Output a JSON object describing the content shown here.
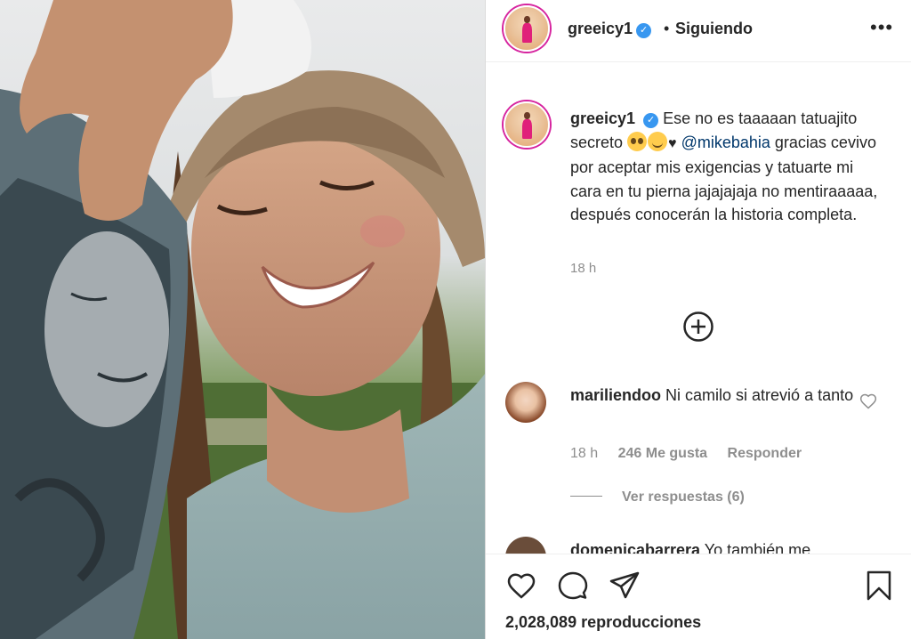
{
  "post": {
    "username": "greeicy1",
    "verified_mark": "✓",
    "separator": "•",
    "follow_status": "Siguiendo",
    "more_icon": "•••",
    "caption_prefix": "Ese no es taaaaan tatuajito secreto",
    "caption_heart": "♥",
    "caption_mention": "@mikebahia",
    "caption_rest": "gracias cevivo por aceptar mis exigencias y tatuarte mi cara en tu pierna jajajajaja no mentiraaaaa, después conocerán la historia completa.",
    "caption_time": "18 h",
    "caption_emojis": [
      "pleading-face-emoji",
      "smiling-face-emoji"
    ]
  },
  "comments": [
    {
      "username": "mariliendoo",
      "text": "Ni camilo si atrevió a tanto",
      "time": "18 h",
      "likes": "246 Me gusta",
      "reply_label": "Responder",
      "view_replies": "Ver respuestas (6)"
    },
    {
      "username": "domenicabarrera",
      "text": "Yo también me"
    }
  ],
  "actions": {
    "icons": [
      "heart-icon",
      "comment-icon",
      "share-icon",
      "bookmark-icon"
    ],
    "views": "2,028,089 reproducciones"
  },
  "colors": {
    "verified_blue": "#3897f0",
    "mention_blue": "#00376b",
    "secondary_text": "#8e8e8e",
    "border": "#dbdbdb"
  }
}
